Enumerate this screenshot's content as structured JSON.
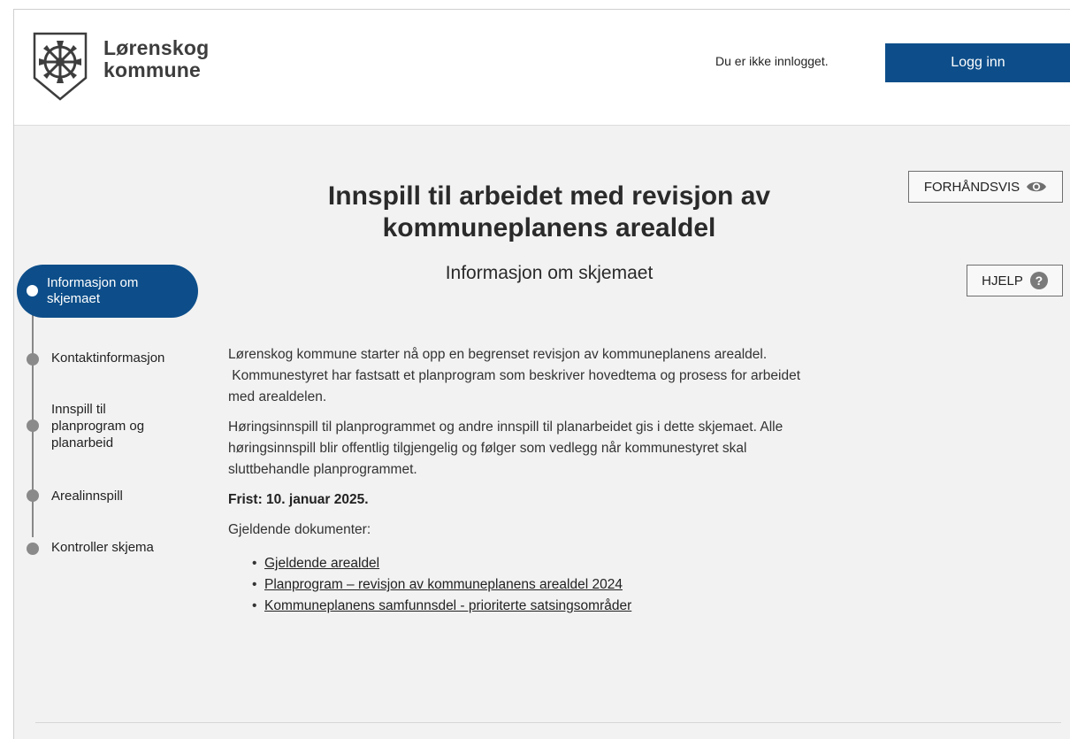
{
  "header": {
    "logo_line1": "Lørenskog",
    "logo_line2": "kommune",
    "login_status": "Du er ikke innlogget.",
    "login_button": "Logg inn"
  },
  "toolbar": {
    "preview_label": "FORHÅNDSVIS",
    "help_label": "HJELP"
  },
  "page": {
    "title_line1": "Innspill til arbeidet med revisjon av",
    "title_line2": "kommuneplanens arealdel",
    "subtitle": "Informasjon om skjemaet"
  },
  "stepper": {
    "active_index": 0,
    "steps": [
      {
        "label_line1": "Informasjon om",
        "label_line2": "skjemaet"
      },
      {
        "label_line1": "Kontaktinformasjon"
      },
      {
        "label_line1": "Innspill til",
        "label_line2": "planprogram og",
        "label_line3": "planarbeid"
      },
      {
        "label_line1": "Arealinnspill"
      },
      {
        "label_line1": "Kontroller skjema"
      }
    ]
  },
  "content": {
    "paragraph1_line1": "Lørenskog kommune starter nå opp en begrenset revisjon av kommuneplanens arealdel.",
    "paragraph1_line2": " Kommunestyret har fastsatt et planprogram som beskriver hovedtema og prosess for arbeidet",
    "paragraph1_line3": "med arealdelen.",
    "paragraph2_line1": "Høringsinnspill til planprogrammet og andre innspill til planarbeidet gis i dette skjemaet. Alle",
    "paragraph2_line2": "høringsinnspill blir offentlig tilgjengelig og følger som vedlegg når kommunestyret skal",
    "paragraph2_line3": "sluttbehandle planprogrammet.",
    "deadline": "Frist: 10. januar 2025.",
    "documents_heading": "Gjeldende dokumenter:",
    "documents": [
      "Gjeldende arealdel",
      "Planprogram – revisjon av kommuneplanens arealdel 2024",
      "Kommuneplanens samfunnsdel - prioriterte satsingsområder "
    ]
  },
  "colors": {
    "brand_blue": "#0d4e8a",
    "page_background": "#f2f2f2",
    "stepper_gray": "#8a8a8a"
  },
  "icons": {
    "logo": "lorenskog-shield-wheel-logo",
    "preview": "eye-icon",
    "help": "question-circle-icon"
  }
}
